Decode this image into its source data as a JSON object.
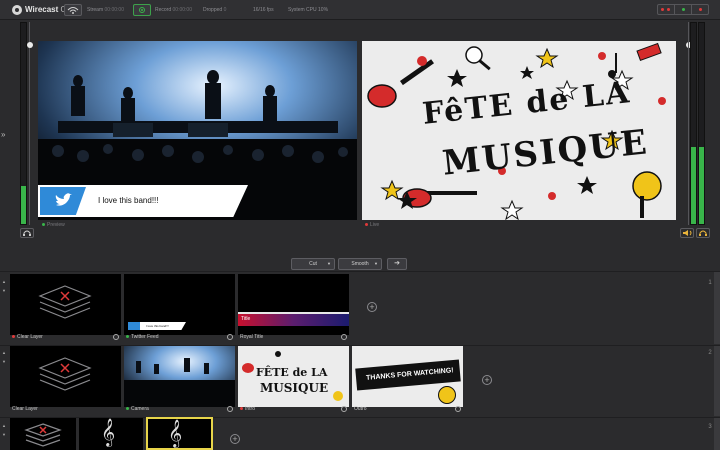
{
  "header": {
    "app_name": "Wirecast",
    "app_edition": "One",
    "stream_label": "Stream",
    "stream_time": "00:00:00",
    "record_label": "Record",
    "record_time": "00:00:00",
    "dropped_label": "Dropped",
    "dropped_value": "0",
    "fps": "16/16 fps",
    "cpu": "System CPU 10%"
  },
  "monitors": {
    "preview_label": "Preview",
    "live_label": "Live",
    "lower_third_text": "I love this band!!!",
    "fete_title_1": "FêTE de LA",
    "fete_title_2": "MUSIQUE"
  },
  "transition": {
    "cut_label": "Cut",
    "smooth_label": "Smooth",
    "go_arrow": "➔"
  },
  "layers": [
    {
      "number": "1",
      "shots": [
        {
          "label": "Clear Layer",
          "status_color": "#e03a3a"
        },
        {
          "label": "Twitter Feed",
          "status_color": "#39b54a"
        },
        {
          "label": "Royal Title",
          "status_color": "#555555"
        }
      ]
    },
    {
      "number": "2",
      "shots": [
        {
          "label": "Clear Layer",
          "status_color": "#555555"
        },
        {
          "label": "Camera",
          "status_color": "#39b54a"
        },
        {
          "label": "Intro",
          "status_color": "#e03a3a"
        },
        {
          "label": "Outro",
          "status_color": "#555555"
        }
      ]
    },
    {
      "number": "3",
      "shots": []
    }
  ],
  "thumb_texts": {
    "twitter_mini": "I love this band!!!",
    "royal_title": "Title",
    "outro_banner": "THANKS FOR WATCHING!"
  },
  "icons": {
    "add": "+",
    "collapse": "»",
    "up": "▲",
    "down": "▼"
  },
  "colors": {
    "accent_green": "#39b54a",
    "status_red": "#e03a3a",
    "twitter_blue": "#2f8ad8",
    "selection_yellow": "#e8d54a"
  }
}
